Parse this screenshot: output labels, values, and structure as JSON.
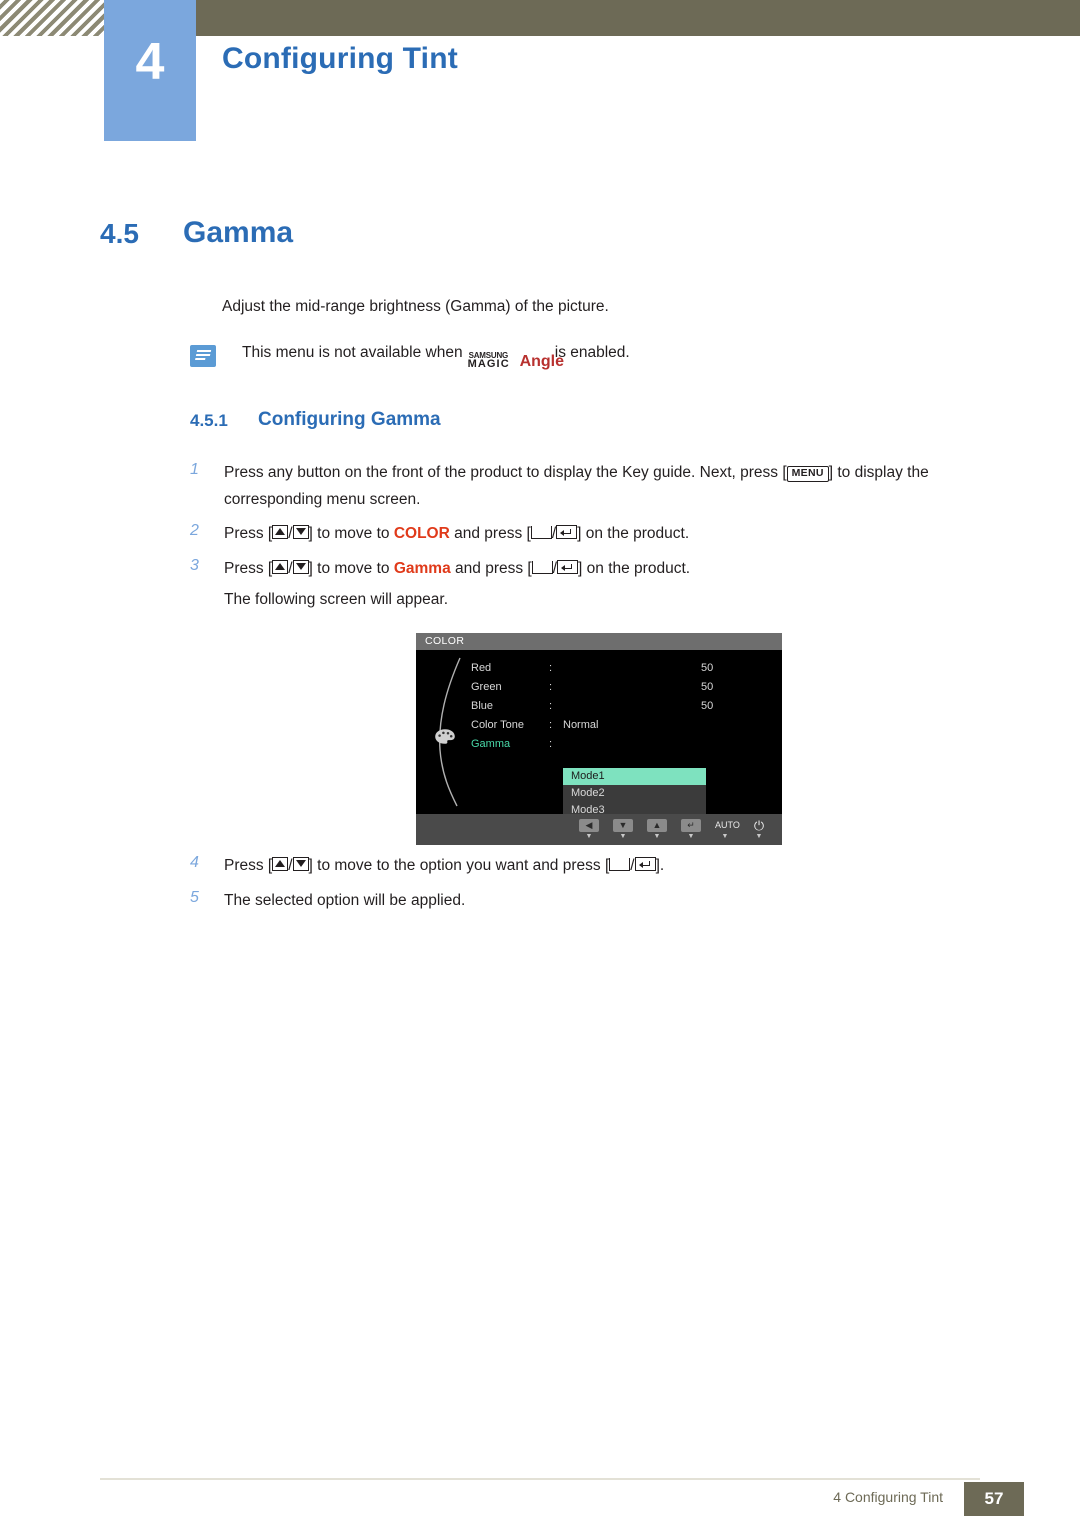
{
  "header": {
    "chapter_number": "4",
    "chapter_title": "Configuring Tint"
  },
  "section": {
    "number": "4.5",
    "title": "Gamma"
  },
  "intro": "Adjust the mid-range brightness (Gamma) of the picture.",
  "note": {
    "text_before": "This menu is not available when",
    "logo_samsung": "SAMSUNG",
    "logo_magic": "MAGIC",
    "logo_angle": "Angle",
    "text_after": "is enabled."
  },
  "subsection": {
    "number": "4.5.1",
    "title": "Configuring Gamma"
  },
  "steps": [
    {
      "num": "1",
      "part1": "Press any button on the front of the product to display the Key guide. Next, press [",
      "key": "MENU",
      "part2": "] to display the corresponding menu screen."
    },
    {
      "num": "2",
      "part1": "Press [",
      "part2": "/",
      "part3": "] to move to ",
      "keyword": "COLOR",
      "part4": " and press [",
      "part5": "/",
      "part6": "] on the product."
    },
    {
      "num": "3",
      "part1": "Press [",
      "part2": "/",
      "part3": "] to move to ",
      "keyword": "Gamma",
      "part4": " and press [",
      "part5": "/",
      "part6": "] on the product."
    }
  ],
  "step3_sub": "The following screen will appear.",
  "steps_after": [
    {
      "num": "4",
      "part1": "Press [",
      "part2": "/",
      "part3": "] to move to the option you want and press [",
      "part4": "/",
      "part5": "]."
    },
    {
      "num": "5",
      "text": "The selected option will be applied."
    }
  ],
  "osd": {
    "title": "COLOR",
    "rows": [
      {
        "label": "Red",
        "colon": ":",
        "type": "bar",
        "fill_percent": 50,
        "value": "50"
      },
      {
        "label": "Green",
        "colon": ":",
        "type": "bar",
        "fill_percent": 50,
        "value": "50"
      },
      {
        "label": "Blue",
        "colon": ":",
        "type": "bar",
        "fill_percent": 50,
        "value": "50"
      },
      {
        "label": "Color Tone",
        "colon": ":",
        "type": "text",
        "value": "Normal"
      },
      {
        "label": "Gamma",
        "colon": ":",
        "type": "menu",
        "value": ""
      }
    ],
    "dropdown": {
      "options": [
        "Mode1",
        "Mode2",
        "Mode3"
      ],
      "selected_index": 0
    },
    "footer_buttons": [
      {
        "name": "left",
        "glyph": "◀",
        "tick": "▼"
      },
      {
        "name": "down",
        "glyph": "▼",
        "tick": "▼"
      },
      {
        "name": "up",
        "glyph": "▲",
        "tick": "▼"
      },
      {
        "name": "enter",
        "glyph": "↵",
        "tick": "▼"
      },
      {
        "name": "auto",
        "glyph": "AUTO",
        "tick": "▼"
      },
      {
        "name": "power",
        "glyph": "⏻",
        "tick": "▼"
      }
    ]
  },
  "footer": {
    "text": "4 Configuring Tint",
    "page": "57"
  },
  "colors": {
    "accent_blue": "#2b6cb5",
    "badge_blue": "#7ba7dd",
    "header_olive": "#6d6a56",
    "keyword_red": "#e03a1a",
    "osd_highlight": "#7ee2bf"
  }
}
